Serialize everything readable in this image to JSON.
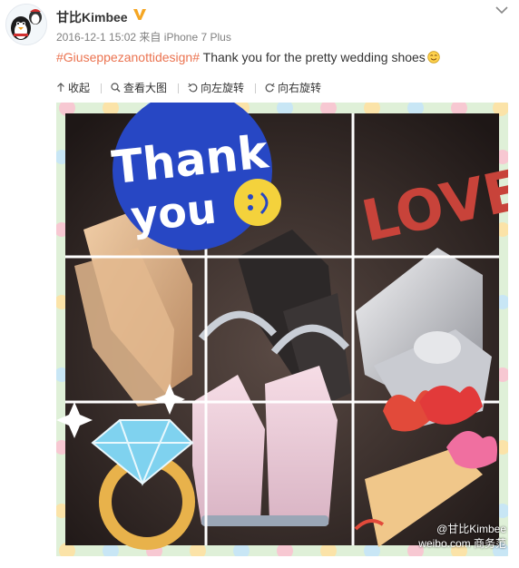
{
  "post": {
    "username": "甘比Kimbee",
    "verified_badge": "V",
    "timestamp": "2016-12-1 15:02",
    "source_prefix": "来自",
    "source": "iPhone 7 Plus",
    "hashtag": "#Giuseppezanottidesign#",
    "text": " Thank you for the pretty wedding shoes",
    "emoji": "smile-emoji"
  },
  "toolbar": {
    "collapse": "收起",
    "view_large": "查看大图",
    "rotate_left": "向左旋转",
    "rotate_right": "向右旋转"
  },
  "photo": {
    "sticker_thank": "Thank",
    "sticker_you": "you",
    "sticker_love": "LOVE"
  },
  "watermark": {
    "handle": "@甘比Kimbee",
    "site": "weibo.com",
    "account": "商务范"
  },
  "colors": {
    "hashtag": "#eb7350",
    "badge": "#f5a623",
    "bubble": "#2747c4",
    "love": "#c8433a",
    "frame_border": "#d9ecd0"
  }
}
